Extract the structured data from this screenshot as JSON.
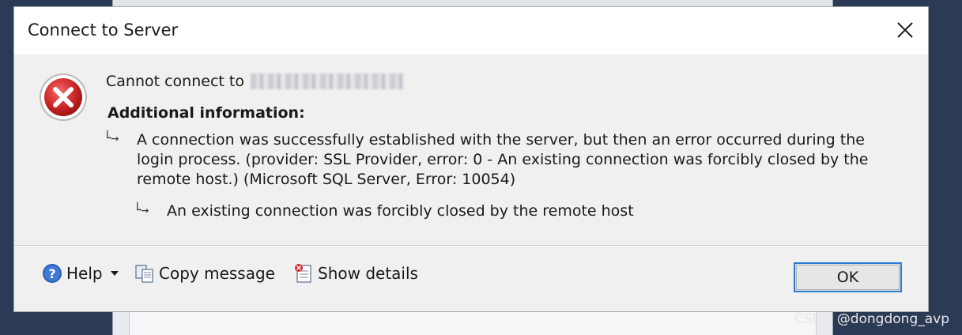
{
  "dialog": {
    "title": "Connect to Server",
    "message_prefix": "Cannot connect to",
    "additional_info_label": "Additional information:",
    "detail_primary": "A connection was successfully established with the server, but then an error occurred during the login process. (provider: SSL Provider, error: 0 - An existing connection was forcibly closed by the remote host.) (Microsoft SQL Server, Error: 10054)",
    "detail_secondary": "An existing connection was forcibly closed by the remote host"
  },
  "footer": {
    "help_label": "Help",
    "copy_label": "Copy message",
    "details_label": "Show details",
    "ok_label": "OK"
  },
  "icons": {
    "error": "error-icon",
    "help": "help-icon",
    "copy": "copy-icon",
    "details": "show-details-icon",
    "close": "close-icon"
  },
  "colors": {
    "error_red": "#c81e1e",
    "focus_blue": "#2a7bd4"
  },
  "watermark": "CSDN @dongdong_avp"
}
